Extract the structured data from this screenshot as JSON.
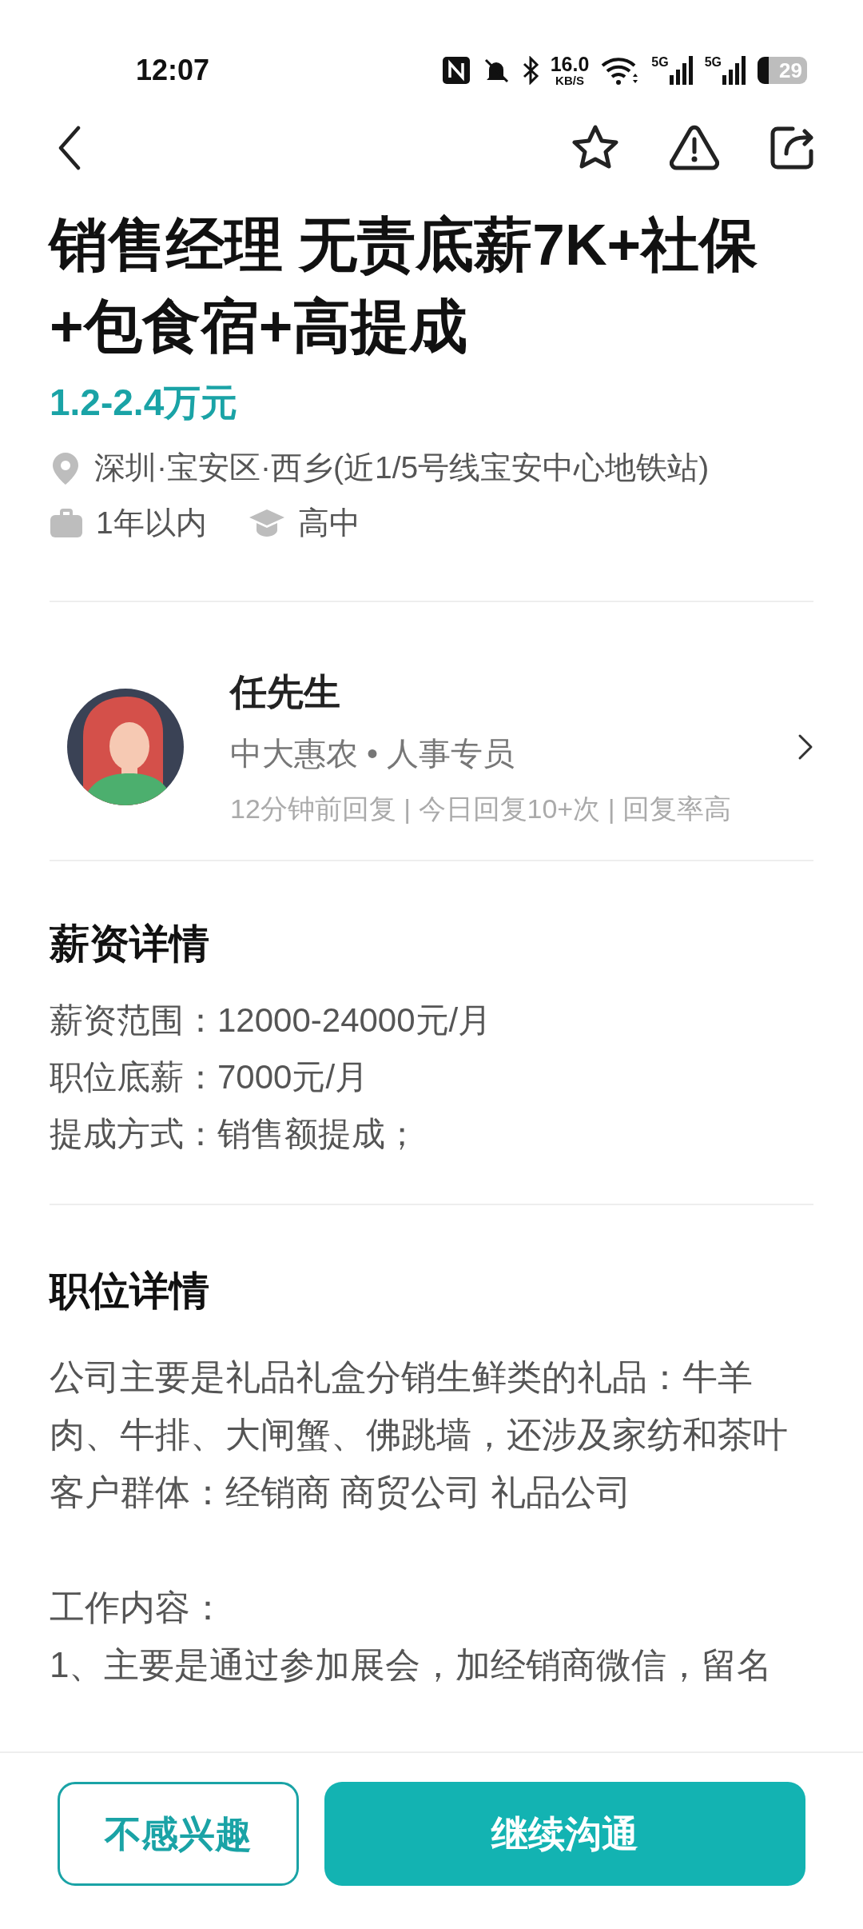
{
  "status_bar": {
    "time": "12:07",
    "net_speed": "16.0",
    "net_unit": "KB/S",
    "sim_1": "5G",
    "sim_2": "5G",
    "battery": "29"
  },
  "job": {
    "title": "销售经理 无责底薪7K+社保+包食宿+高提成",
    "salary": "1.2-2.4万元",
    "location": "深圳·宝安区·西乡(近1/5号线宝安中心地铁站)",
    "experience": "1年以内",
    "education": "高中"
  },
  "recruiter": {
    "name": "任先生",
    "company_role": "中大惠农 • 人事专员",
    "activity": "12分钟前回复 | 今日回复10+次 | 回复率高"
  },
  "salary_details": {
    "heading": "薪资详情",
    "lines": [
      "薪资范围：12000-24000元/月",
      "职位底薪：7000元/月",
      "提成方式：销售额提成；"
    ]
  },
  "job_details": {
    "heading": "职位详情",
    "paragraphs": [
      [
        "公司主要是礼品礼盒分销生鲜类的礼品：牛羊",
        "肉、牛排、大闸蟹、佛跳墙，还涉及家纺和茶叶",
        "客户群体：经销商 商贸公司 礼品公司"
      ],
      [
        "工作内容：",
        "1、主要是通过参加展会，加经销商微信，留名"
      ]
    ]
  },
  "buttons": [
    {
      "kind": "outline",
      "label": "不感兴趣"
    },
    {
      "kind": "filled",
      "label": "继续沟通"
    }
  ]
}
